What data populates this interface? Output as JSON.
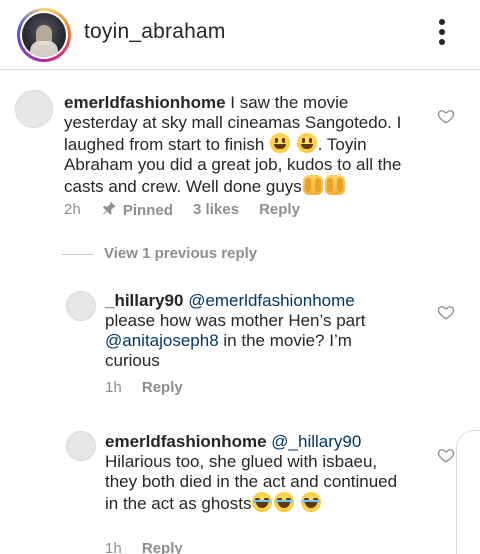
{
  "header": {
    "username": "toyin_abraham",
    "more_icon": "more-vertical-icon"
  },
  "comments": [
    {
      "user": "emerldfashionhome",
      "text_1": " I saw the movie yesterday at sky mall cineamas Sangotedo. I laughed from start to finish ",
      "text_2": ". Toyin Abraham you did a great job, kudos to all the casts and crew. Well done guys",
      "time": "2h",
      "pinned": "Pinned",
      "likes": "3 likes",
      "reply": "Reply"
    },
    {
      "user": "_hillary90",
      "mention_1": "@emerldfashionhome",
      "text_1": "please how was mother Hen’s part ",
      "mention_2": "@anitajoseph8",
      "text_2": " in the movie? I’m curious",
      "time": "1h",
      "reply": "Reply"
    },
    {
      "user": "emerldfashionhome",
      "mention_1": "@_hillary90",
      "text_1": "Hilarious too, she glued with isbaeu, they both died in the act and continued in the act as ghosts",
      "time": "1h",
      "reply": "Reply"
    }
  ],
  "view_previous": "View 1 previous reply",
  "icons": {
    "heart": "heart-outline-icon",
    "pin": "pin-icon",
    "emoji_grin": "grinning-face-icon",
    "emoji_hands": "raising-hands-icon",
    "emoji_laugh": "tears-of-joy-icon"
  },
  "colors": {
    "text": "#262626",
    "meta": "#8e8e8e",
    "mention": "#00376b",
    "divider": "#dbdbdb"
  }
}
